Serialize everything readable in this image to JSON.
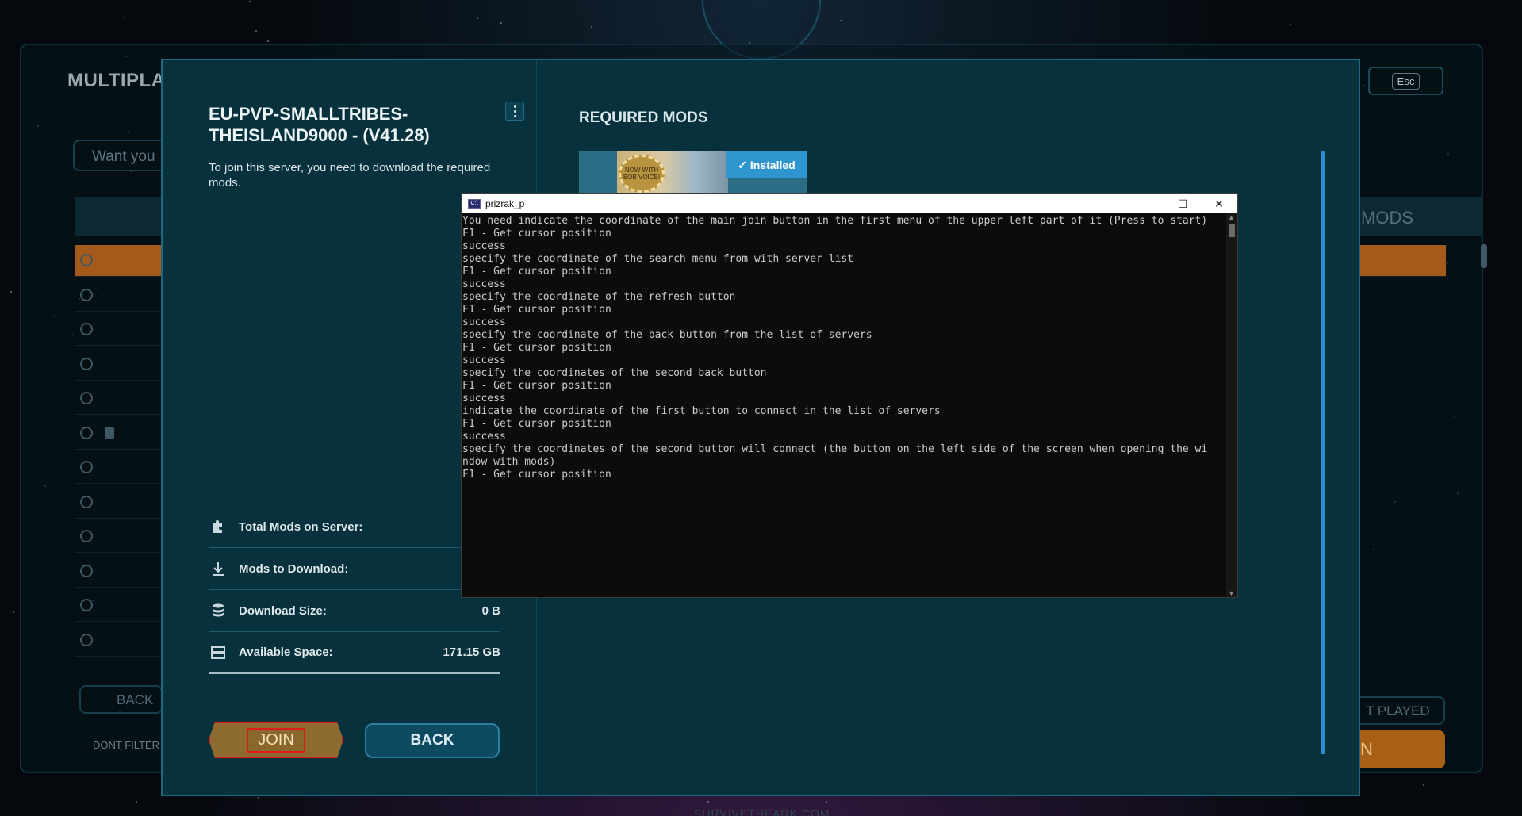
{
  "background": {
    "title": "MULTIPLAYER",
    "esc_label": "Esc",
    "search_placeholder": "Want you",
    "mods_col_label": "MODS",
    "back_label": "BACK",
    "dont_filter_label": "DONT FILTER",
    "last_played_label": "T PLAYED",
    "join_label": "N",
    "footer_text": "SURVIVETHEARK.COM"
  },
  "dialog": {
    "server_name": "EU-PVP-SMALLTRIBES-THEISLAND9000 - (V41.28)",
    "description": "To join this server, you need to download the required mods.",
    "stats": [
      {
        "icon": "puzzle-icon",
        "label": "Total Mods on Server:",
        "value": ""
      },
      {
        "icon": "download-icon",
        "label": "Mods to Download:",
        "value": ""
      },
      {
        "icon": "database-icon",
        "label": "Download Size:",
        "value": "0 B"
      },
      {
        "icon": "storage-icon",
        "label": "Available Space:",
        "value": "171.15 GB"
      }
    ],
    "join_button": "JOIN",
    "back_button": "BACK",
    "required_mods_title": "REQUIRED MODS",
    "mods": [
      {
        "badge_text": "NOW WITH BOB VOICE!",
        "status": "✓ Installed"
      }
    ]
  },
  "console": {
    "window_title": "prizrak_p",
    "controls": {
      "minimize": "—",
      "maximize": "☐",
      "close": "✕"
    },
    "lines": [
      "You need indicate the coordinate of the main join button in the first menu of the upper left part of it (Press to start)",
      "F1 - Get cursor position",
      "success",
      "specify the coordinate of the search menu from with server list",
      "F1 - Get cursor position",
      "success",
      "specify the coordinate of the refresh button",
      "F1 - Get cursor position",
      "success",
      "specify the coordinate of the back button from the list of servers",
      "F1 - Get cursor position",
      "success",
      "specify the coordinates of the second back button",
      "F1 - Get cursor position",
      "success",
      "indicate the coordinate of the first button to connect in the list of servers",
      "F1 - Get cursor position",
      "success",
      "specify the coordinates of the second button will connect (the button on the left side of the screen when opening the wi",
      "ndow with mods)",
      "F1 - Get cursor position"
    ]
  }
}
